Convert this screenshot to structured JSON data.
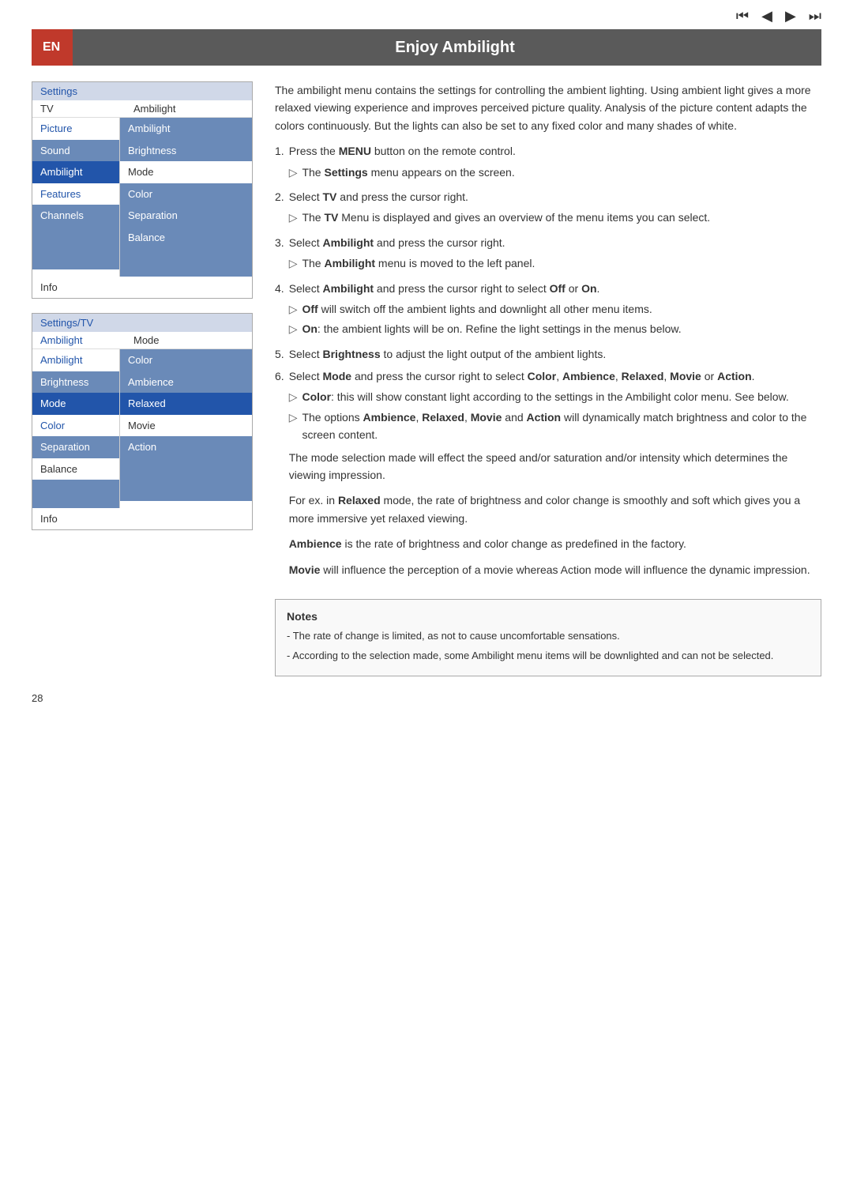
{
  "header": {
    "en_label": "EN",
    "title": "Enjoy Ambilight"
  },
  "nav_icons": [
    "⏮",
    "◀",
    "▶",
    "⏭"
  ],
  "menu1": {
    "header": "Settings",
    "tv_label": "TV",
    "tv_value": "Ambilight",
    "left_items": [
      {
        "label": "Picture",
        "style": "blue"
      },
      {
        "label": "Sound",
        "style": "blue"
      },
      {
        "label": "Ambilight",
        "style": "active"
      },
      {
        "label": "Features",
        "style": "blue"
      },
      {
        "label": "Channels",
        "style": "blue"
      }
    ],
    "right_items": [
      {
        "label": "Ambilight",
        "style": "highlight"
      },
      {
        "label": "Brightness",
        "style": "highlight"
      },
      {
        "label": "Mode",
        "style": "dark"
      },
      {
        "label": "Color",
        "style": "plain"
      },
      {
        "label": "Separation",
        "style": "dark"
      },
      {
        "label": "Balance",
        "style": "dark"
      }
    ],
    "info_label": "Info"
  },
  "menu2": {
    "header": "Settings/TV",
    "ambilight_label": "Ambilight",
    "mode_label": "Mode",
    "left_items": [
      {
        "label": "Ambilight",
        "style": "blue"
      },
      {
        "label": "Brightness",
        "style": "blue"
      },
      {
        "label": "Mode",
        "style": "active"
      },
      {
        "label": "Color",
        "style": "blue"
      },
      {
        "label": "Separation",
        "style": "blue"
      },
      {
        "label": "Balance",
        "style": "plain"
      }
    ],
    "right_items": [
      {
        "label": "Color",
        "style": "highlight"
      },
      {
        "label": "Ambience",
        "style": "highlight"
      },
      {
        "label": "Relaxed",
        "style": "selected"
      },
      {
        "label": "Movie",
        "style": "plain"
      },
      {
        "label": "Action",
        "style": "plain"
      }
    ],
    "info_label": "Info"
  },
  "body_text": {
    "intro": "The ambilight menu contains the settings for controlling the ambient lighting. Using ambient light gives a more relaxed viewing experience and improves perceived picture quality. Analysis of the picture content adapts the colors continuously. But the lights can also be set to any fixed color and many shades of white.",
    "steps": [
      {
        "num": "1.",
        "text": "Press the ",
        "bold": "MENU",
        "rest": " button on the remote control.",
        "sub": [
          {
            "text": "The ",
            "bold": "Settings",
            "rest": " menu appears on the screen."
          }
        ]
      },
      {
        "num": "2.",
        "text": "Select ",
        "bold": "TV",
        "rest": " and press the cursor right.",
        "sub": [
          {
            "text": "The ",
            "bold": "TV",
            "rest": " Menu is displayed and gives an overview of the menu items you can select."
          }
        ]
      },
      {
        "num": "3.",
        "text": "Select ",
        "bold": "Ambilight",
        "rest": " and press the cursor right.",
        "sub": [
          {
            "text": "The ",
            "bold": "Ambilight",
            "rest": " menu is moved to the left panel."
          }
        ]
      },
      {
        "num": "4.",
        "text": "Select ",
        "bold": "Ambilight",
        "rest": " and press the cursor right to select ",
        "bold2": "Off",
        "rest2": " or ",
        "bold3": "On",
        "rest3": ".",
        "sub": [
          {
            "bold": "Off",
            "rest": " will switch off the ambient lights and downlight all other menu items."
          },
          {
            "bold": "On",
            "rest": ": the ambient lights will be on. Refine the light settings in the menus below."
          }
        ]
      },
      {
        "num": "5.",
        "text": "Select ",
        "bold": "Brightness",
        "rest": " to adjust the light output of the ambient lights."
      },
      {
        "num": "6.",
        "text": "Select ",
        "bold": "Mode",
        "rest": " and press the cursor right to select ",
        "bold2": "Color",
        "rest2": ", ",
        "bold3": "Ambience",
        "rest3": ", ",
        "bold4": "Relaxed",
        "rest4": ", ",
        "bold5": "Movie",
        "rest5": " or ",
        "bold6": "Action",
        "rest6": ".",
        "sub": [
          {
            "bold": "Color",
            "rest": ": this will show constant light according to the settings in the Ambilight color menu. See below."
          },
          {
            "text": "The options ",
            "bold": "Ambience",
            "rest": ", ",
            "bold2": "Relaxed",
            "rest2": ", ",
            "bold3": "Movie",
            "rest3": " and ",
            "bold4": "Action",
            "rest4": " will dynamically match brightness and color to the screen content."
          }
        ],
        "extra": [
          "The mode selection made will effect the speed and/or saturation and/or intensity which determines the viewing impression.",
          "For ex. in Relaxed mode, the rate of brightness and color change is smoothly and soft which gives you a more immersive yet relaxed viewing.",
          "Ambience is the rate of brightness and color change as predefined in the factory.",
          "Movie will influence the perception of a movie whereas Action mode will influence the dynamic impression."
        ]
      }
    ],
    "notes": {
      "title": "Notes",
      "items": [
        "- The rate of change is limited, as not to cause uncomfortable sensations.",
        "- According to the selection made, some Ambilight menu items will be downlighted and can not be selected."
      ]
    }
  },
  "footer": {
    "page_num": "28"
  }
}
